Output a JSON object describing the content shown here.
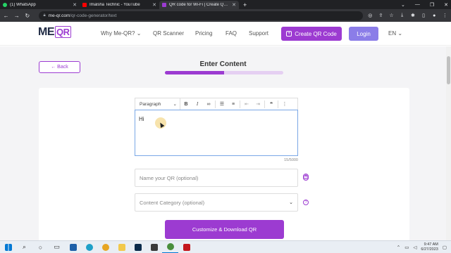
{
  "browser": {
    "tabs": [
      {
        "title": "(1) WhatsApp",
        "color": "#25d366"
      },
      {
        "title": "Imalsha Technic - YouTube",
        "color": "#ff0000"
      },
      {
        "title": "QR code for Wi-Fi | Create QR tr...",
        "color": "#9c3bd1"
      }
    ],
    "new_tab": "+",
    "url_domain": "me-qr.com",
    "url_path": "/qr-code-generator/text"
  },
  "header": {
    "logo_me": "ME",
    "logo_qr": "QR",
    "nav": [
      "Why Me-QR?",
      "QR Scanner",
      "Pricing",
      "FAQ",
      "Support"
    ],
    "create_label": "Create QR Code",
    "login_label": "Login",
    "lang": "EN"
  },
  "page": {
    "back_label": "← Back",
    "title": "Enter Content",
    "progress": 0.5,
    "editor": {
      "paragraph_label": "Paragraph",
      "text": "Hi",
      "counter": "15/5000"
    },
    "name_placeholder": "Name your QR (optional)",
    "category_placeholder": "Content Category (optional)",
    "download_label": "Customize & Download QR"
  },
  "taskbar": {
    "time": "9:47 AM",
    "date": "6/27/2023"
  }
}
